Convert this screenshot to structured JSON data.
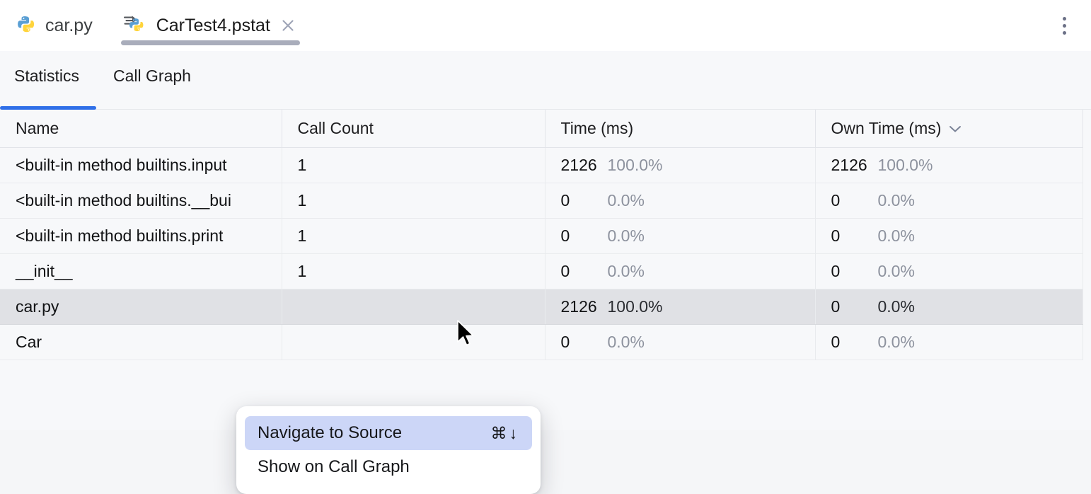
{
  "editor_tabs": [
    {
      "label": "car.py",
      "icon": "python-file-icon",
      "active": false,
      "closable": false
    },
    {
      "label": "CarTest4.pstat",
      "icon": "python-profile-file-icon",
      "active": true,
      "closable": true
    }
  ],
  "window_menu": {
    "icon": "kebab-menu-icon"
  },
  "view_tabs": [
    {
      "label": "Statistics",
      "active": true
    },
    {
      "label": "Call Graph",
      "active": false
    }
  ],
  "table": {
    "columns": [
      {
        "label": "Name",
        "sorted": false
      },
      {
        "label": "Call Count",
        "sorted": false
      },
      {
        "label": "Time (ms)",
        "sorted": false
      },
      {
        "label": "Own Time (ms)",
        "sorted": true,
        "sort_icon": "chevron-down-icon"
      }
    ],
    "rows": [
      {
        "name": "<built-in method builtins.input",
        "call_count": "1",
        "time": "2126",
        "time_pct": "100.0%",
        "own_time": "2126",
        "own_time_pct": "100.0%",
        "selected": false
      },
      {
        "name": "<built-in method builtins.__bui",
        "call_count": "1",
        "time": "0",
        "time_pct": "0.0%",
        "own_time": "0",
        "own_time_pct": "0.0%",
        "selected": false
      },
      {
        "name": "<built-in method builtins.print",
        "call_count": "1",
        "time": "0",
        "time_pct": "0.0%",
        "own_time": "0",
        "own_time_pct": "0.0%",
        "selected": false
      },
      {
        "name": "__init__",
        "call_count": "1",
        "time": "0",
        "time_pct": "0.0%",
        "own_time": "0",
        "own_time_pct": "0.0%",
        "selected": false
      },
      {
        "name": "car.py",
        "call_count": "",
        "time": "2126",
        "time_pct": "100.0%",
        "own_time": "0",
        "own_time_pct": "0.0%",
        "selected": true
      },
      {
        "name": "Car",
        "call_count": "",
        "time": "0",
        "time_pct": "0.0%",
        "own_time": "0",
        "own_time_pct": "0.0%",
        "selected": false
      }
    ]
  },
  "context_menu": {
    "items": [
      {
        "label": "Navigate to Source",
        "shortcut": "⌘↓",
        "highlighted": true
      },
      {
        "label": "Show on Call Graph",
        "shortcut": "",
        "highlighted": false
      }
    ]
  },
  "colors": {
    "accent_tab_underline": "#2f6fe8",
    "menu_highlight": "#ccd6f7",
    "row_selected": "#e0e1e5",
    "surface": "#f7f8fa",
    "python_blue": "#4b8bbe",
    "python_yellow": "#ffd43b"
  }
}
